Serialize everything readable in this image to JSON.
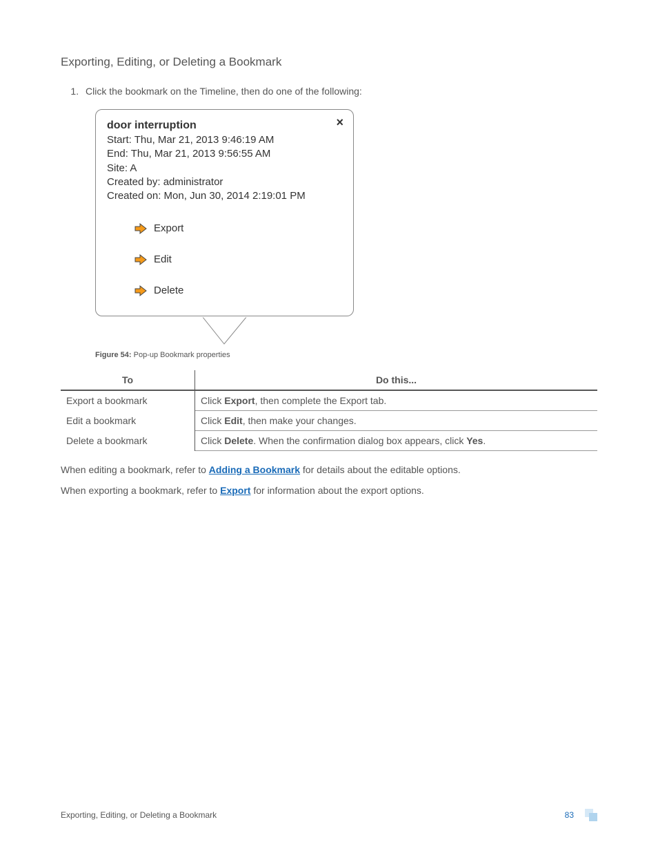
{
  "heading": "Exporting, Editing, or Deleting a Bookmark",
  "step1": "Click the bookmark on the Timeline, then do one of the following:",
  "popup": {
    "title": "door interruption",
    "start": "Start: Thu, Mar 21, 2013 9:46:19 AM",
    "end": "End: Thu, Mar 21, 2013 9:56:55 AM",
    "site": "Site: A",
    "created_by": "Created by: administrator",
    "created_on": "Created on: Mon, Jun 30, 2014 2:19:01 PM",
    "actions": {
      "export": "Export",
      "edit": "Edit",
      "delete": "Delete"
    },
    "close": "×"
  },
  "figure": {
    "label": "Figure 54:",
    "caption": " Pop-up Bookmark properties"
  },
  "table": {
    "headers": {
      "to": "To",
      "do": "Do this..."
    },
    "rows": [
      {
        "to": "Export a bookmark",
        "pre": "Click ",
        "bold1": "Export",
        "post": ", then complete the Export tab."
      },
      {
        "to": "Edit a bookmark",
        "pre": "Click ",
        "bold1": "Edit",
        "post": ", then make your changes."
      },
      {
        "to": "Delete a bookmark",
        "pre": "Click ",
        "bold1": "Delete",
        "mid": ". When the confirmation dialog box appears, click ",
        "bold2": "Yes",
        "post": "."
      }
    ]
  },
  "para_edit": {
    "pre": "When editing a bookmark, refer to ",
    "link": "Adding a Bookmark",
    "post": " for details about the editable options."
  },
  "para_export": {
    "pre": "When exporting a bookmark, refer to ",
    "link": "Export",
    "post": " for information about the export options."
  },
  "footer": {
    "title": "Exporting, Editing, or Deleting a Bookmark",
    "page": "83"
  }
}
